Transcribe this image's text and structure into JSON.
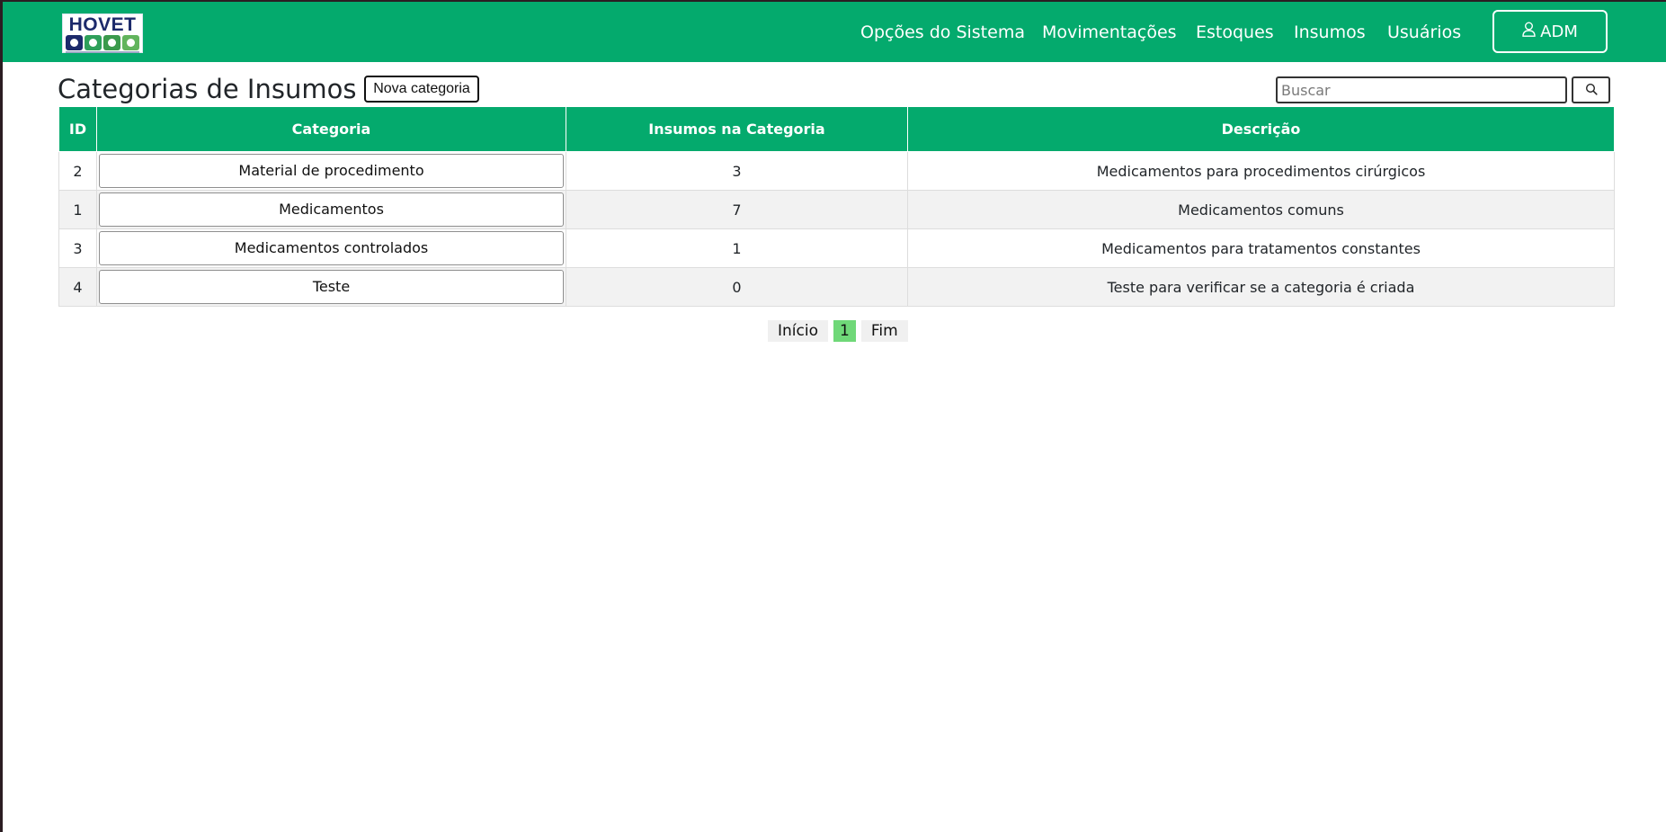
{
  "logo": {
    "text": "HOVET",
    "tile_colors": [
      "#1c2a6b",
      "#2ea05a",
      "#3b9a4c",
      "#62b45d"
    ]
  },
  "nav": {
    "items": [
      {
        "label": "Opções do Sistema"
      },
      {
        "label": "Movimentações"
      },
      {
        "label": "Estoques"
      },
      {
        "label": "Insumos"
      },
      {
        "label": "Usuários"
      }
    ],
    "user_label": "ADM",
    "user_icon": "user-icon"
  },
  "page": {
    "title": "Categorias de Insumos",
    "new_button": "Nova categoria"
  },
  "search": {
    "placeholder": "Buscar",
    "value": "",
    "icon": "search-icon"
  },
  "table": {
    "columns": [
      "ID",
      "Categoria",
      "Insumos na Categoria",
      "Descrição"
    ],
    "rows": [
      {
        "id": "2",
        "categoria": "Material de procedimento",
        "insumos": "3",
        "descricao": "Medicamentos para procedimentos cirúrgicos"
      },
      {
        "id": "1",
        "categoria": "Medicamentos",
        "insumos": "7",
        "descricao": "Medicamentos comuns"
      },
      {
        "id": "3",
        "categoria": "Medicamentos controlados",
        "insumos": "1",
        "descricao": "Medicamentos para tratamentos constantes"
      },
      {
        "id": "4",
        "categoria": "Teste",
        "insumos": "0",
        "descricao": "Teste para verificar se a categoria é criada"
      }
    ]
  },
  "pagination": {
    "first": "Início",
    "current": "1",
    "last": "Fim"
  },
  "colors": {
    "brand": "#04aa6d",
    "active_page": "#6fd878"
  }
}
